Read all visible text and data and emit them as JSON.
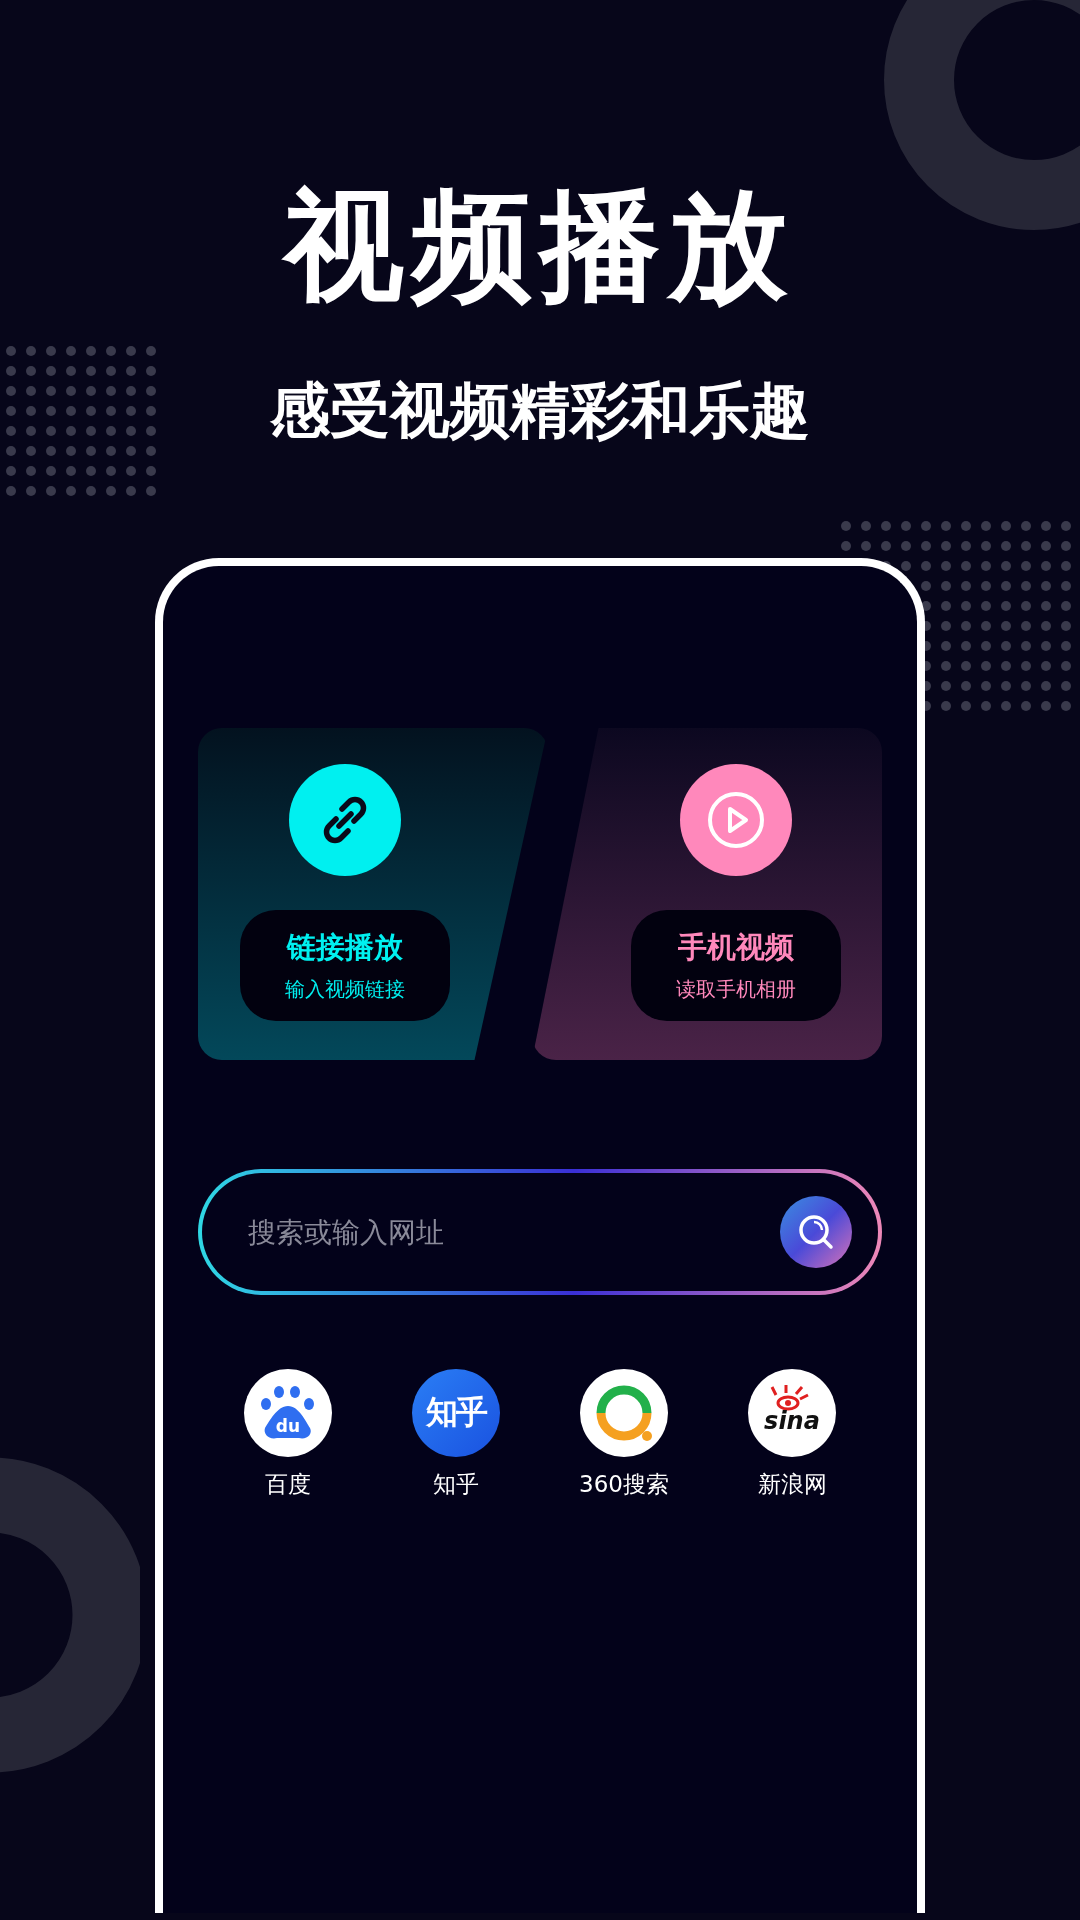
{
  "headline": "视频播放",
  "tagline": "感受视频精彩和乐趣",
  "feature_cards": [
    {
      "kind": "link",
      "title": "链接播放",
      "subtitle": "输入视频链接",
      "color": "#00f0f0"
    },
    {
      "kind": "album",
      "title": "手机视频",
      "subtitle": "读取手机相册",
      "color": "#ff88bb"
    }
  ],
  "search": {
    "placeholder": "搜索或输入网址"
  },
  "shortcuts": [
    {
      "kind": "baidu",
      "label": "百度",
      "logo_text": "du"
    },
    {
      "kind": "zhihu",
      "label": "知乎",
      "logo_text": "知乎"
    },
    {
      "kind": "so360",
      "label": "360搜索"
    },
    {
      "kind": "sina",
      "label": "新浪网",
      "logo_text": "sina"
    }
  ]
}
